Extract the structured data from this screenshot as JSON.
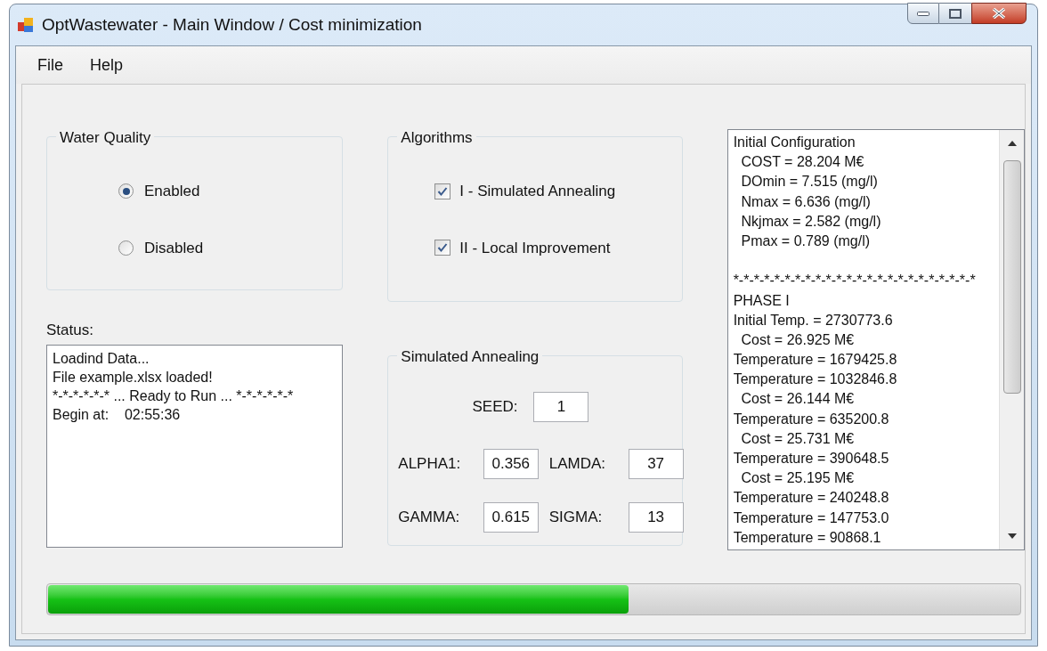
{
  "window": {
    "title": "OptWastewater - Main Window / Cost minimization"
  },
  "menu": [
    "File",
    "Help"
  ],
  "water_quality": {
    "title": "Water Quality",
    "options": [
      {
        "label": "Enabled",
        "selected": true
      },
      {
        "label": "Disabled",
        "selected": false
      }
    ]
  },
  "algorithms": {
    "title": "Algorithms",
    "options": [
      {
        "label": "I - Simulated Annealing",
        "checked": true
      },
      {
        "label": "II - Local Improvement",
        "checked": true
      }
    ]
  },
  "status": {
    "label": "Status:",
    "lines": [
      "Loadind Data...",
      "File example.xlsx loaded!",
      "*-*-*-*-*-* ... Ready to Run ... *-*-*-*-*-*",
      "Begin at:    02:55:36"
    ]
  },
  "simulated_annealing": {
    "title": "Simulated Annealing",
    "seed": {
      "label": "SEED:",
      "value": "1"
    },
    "params": [
      {
        "label": "ALPHA1:",
        "value": "0.356"
      },
      {
        "label": "LAMDA:",
        "value": "37"
      },
      {
        "label": "GAMMA:",
        "value": "0.615"
      },
      {
        "label": "SIGMA:",
        "value": "13"
      }
    ]
  },
  "log_header": [
    "Initial Configuration",
    "  COST = 28.204 M€",
    "  DOmin = 7.515 (mg/l)",
    "  Nmax = 6.636 (mg/l)",
    "  Nkjmax = 2.582 (mg/l)",
    "  Pmax = 0.789 (mg/l)"
  ],
  "log_separator": "*-*-*-*-*-*-*-*-*-*-*-*-*-*-*-*-*-*-*-*-*-*-*-*",
  "log": [
    "PHASE I",
    "Initial Temp. = 2730773.6",
    "  Cost = 26.925 M€",
    "Temperature = 1679425.8",
    "Temperature = 1032846.8",
    "  Cost = 26.144 M€",
    "Temperature = 635200.8",
    "  Cost = 25.731 M€",
    "Temperature = 390648.5",
    "  Cost = 25.195 M€",
    "Temperature = 240248.8",
    "Temperature = 147753.0",
    "Temperature = 90868.1"
  ],
  "progress": {
    "level": 0.598
  }
}
